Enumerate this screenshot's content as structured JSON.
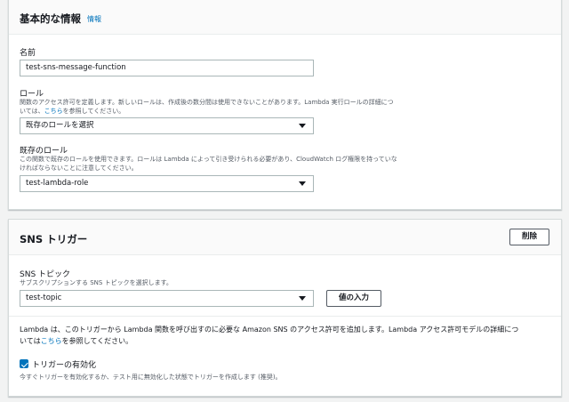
{
  "basic": {
    "title": "基本的な情報",
    "info_link": "情報",
    "name_label": "名前",
    "name_value": "test-sns-message-function",
    "role_label": "ロール",
    "role_desc_1": "関数のアクセス許可を定義します。新しいロールは、作成後の数分間は使用できないことがあります。Lambda 実行ロールの詳細につ",
    "role_desc_2a": "いては、",
    "role_desc_link": "こちら",
    "role_desc_2b": "を参照してください。",
    "role_select": "既存のロールを選択",
    "existing_role_label": "既存のロール",
    "existing_role_desc_1": "この関数で既存のロールを使用できます。ロールは Lambda によって引き受けられる必要があり、CloudWatch ログ権限を持っていな",
    "existing_role_desc_2": "ければならないことに注意してください。",
    "existing_role_select": "test-lambda-role"
  },
  "sns": {
    "title": "SNS トリガー",
    "delete_button": "削除",
    "topic_label": "SNS トピック",
    "topic_desc": "サブスクリプションする SNS トピックを選択します。",
    "topic_select": "test-topic",
    "enter_value_button": "値の入力",
    "permission_text_1": "Lambda は、このトリガーから Lambda 関数を呼び出すのに必要な Amazon SNS のアクセス許可を追加します。Lambda アクセス許可モデルの詳細につ",
    "permission_text_2a": "いては",
    "permission_link": "こちら",
    "permission_text_2b": "を参照してください。",
    "enable_trigger_label": "トリガーの有効化",
    "enable_trigger_checked": true,
    "enable_trigger_desc": "今すぐトリガーを有効化するか、テスト用に無効化した状態でトリガーを作成します (推奨)。"
  },
  "colors": {
    "link": "#0073bb",
    "checkbox": "#0073bb"
  }
}
